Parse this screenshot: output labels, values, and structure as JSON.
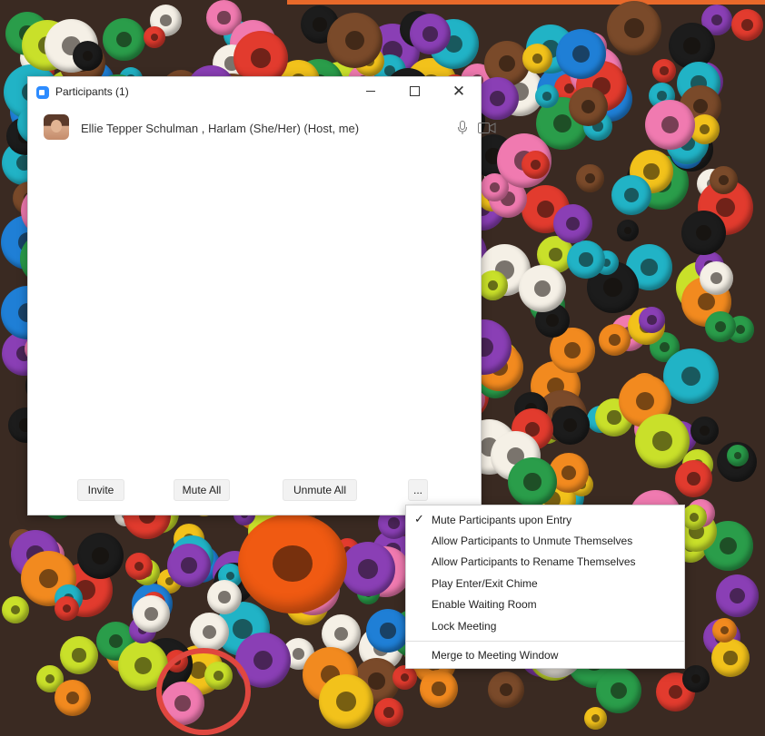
{
  "window": {
    "title": "Participants (1)",
    "close_glyph": "✕"
  },
  "participants": [
    {
      "name": "Ellie Tepper Schulman , Harlam (She/Her) (Host, me)",
      "mic_icon": "microphone-icon",
      "camera_icon": "video-camera-icon"
    }
  ],
  "footer": {
    "invite_label": "Invite",
    "mute_all_label": "Mute All",
    "unmute_all_label": "Unmute All",
    "more_label": "..."
  },
  "menu": {
    "items": [
      {
        "label": "Mute Participants upon Entry",
        "checked": true,
        "check_glyph": "✓"
      },
      {
        "label": "Allow Participants to Unmute Themselves",
        "checked": false
      },
      {
        "label": "Allow Participants to Rename Themselves",
        "checked": false
      },
      {
        "label": "Play Enter/Exit Chime",
        "checked": false
      },
      {
        "label": "Enable Waiting Room",
        "checked": false
      },
      {
        "label": "Lock Meeting",
        "checked": false
      }
    ],
    "merge_label": "Merge to Meeting Window"
  },
  "colors": {
    "accent": "#2d8cff",
    "top_strip": "#e8692a"
  }
}
